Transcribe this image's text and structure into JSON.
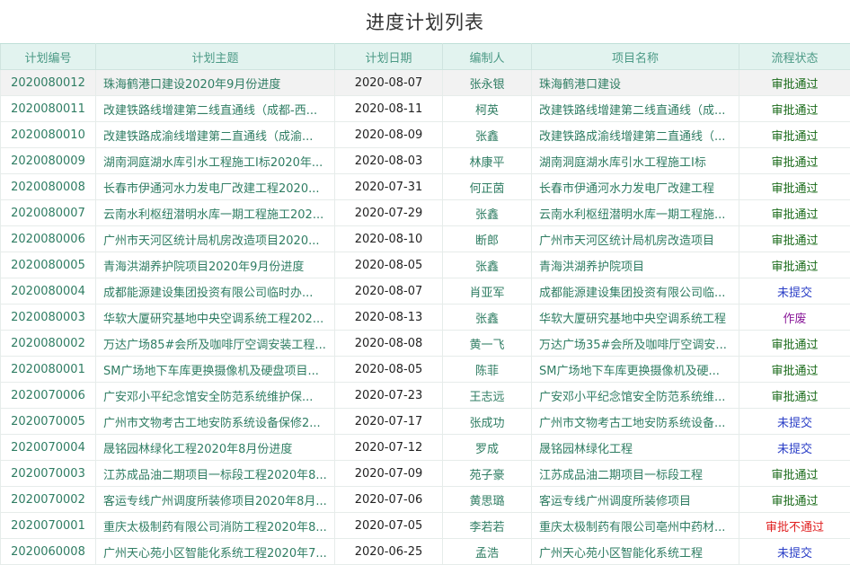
{
  "page": {
    "title": "进度计划列表"
  },
  "table": {
    "columns": [
      "计划编号",
      "计划主题",
      "计划日期",
      "编制人",
      "项目名称",
      "流程状态"
    ],
    "rows": [
      {
        "code": "2020080012",
        "topic": "珠海鹤港口建设2020年9月份进度",
        "date": "2020-08-07",
        "author": "张永银",
        "project": "珠海鹤港口建设",
        "status": "审批通过",
        "status_type": "approved"
      },
      {
        "code": "2020080011",
        "topic": "改建铁路线增建第二线直通线（成都-西...",
        "date": "2020-08-11",
        "author": "柯英",
        "project": "改建铁路线增建第二线直通线（成...",
        "status": "审批通过",
        "status_type": "approved"
      },
      {
        "code": "2020080010",
        "topic": "改建铁路成渝线增建第二直通线（成渝...",
        "date": "2020-08-09",
        "author": "张鑫",
        "project": "改建铁路成渝线增建第二直通线（...",
        "status": "审批通过",
        "status_type": "approved"
      },
      {
        "code": "2020080009",
        "topic": "湖南洞庭湖水库引水工程施工I标2020年...",
        "date": "2020-08-03",
        "author": "林康平",
        "project": "湖南洞庭湖水库引水工程施工I标",
        "status": "审批通过",
        "status_type": "approved"
      },
      {
        "code": "2020080008",
        "topic": "长春市伊通河水力发电厂改建工程2020...",
        "date": "2020-07-31",
        "author": "何正茵",
        "project": "长春市伊通河水力发电厂改建工程",
        "status": "审批通过",
        "status_type": "approved"
      },
      {
        "code": "2020080007",
        "topic": "云南水利枢纽潜明水库一期工程施工202...",
        "date": "2020-07-29",
        "author": "张鑫",
        "project": "云南水利枢纽潜明水库一期工程施...",
        "status": "审批通过",
        "status_type": "approved"
      },
      {
        "code": "2020080006",
        "topic": "广州市天河区统计局机房改造项目2020...",
        "date": "2020-08-10",
        "author": "断郎",
        "project": "广州市天河区统计局机房改造项目",
        "status": "审批通过",
        "status_type": "approved"
      },
      {
        "code": "2020080005",
        "topic": "青海洪湖养护院项目2020年9月份进度",
        "date": "2020-08-05",
        "author": "张鑫",
        "project": "青海洪湖养护院项目",
        "status": "审批通过",
        "status_type": "approved"
      },
      {
        "code": "2020080004",
        "topic": "成都能源建设集团投资有限公司临时办...",
        "date": "2020-08-07",
        "author": "肖亚军",
        "project": "成都能源建设集团投资有限公司临...",
        "status": "未提交",
        "status_type": "unsubmitted"
      },
      {
        "code": "2020080003",
        "topic": "华软大厦研究基地中央空调系统工程202...",
        "date": "2020-08-13",
        "author": "张鑫",
        "project": "华软大厦研究基地中央空调系统工程",
        "status": "作废",
        "status_type": "void"
      },
      {
        "code": "2020080002",
        "topic": "万达广场85#会所及咖啡厅空调安装工程...",
        "date": "2020-08-08",
        "author": "黄一飞",
        "project": "万达广场35#会所及咖啡厅空调安...",
        "status": "审批通过",
        "status_type": "approved"
      },
      {
        "code": "2020080001",
        "topic": "SM广场地下车库更换摄像机及硬盘项目...",
        "date": "2020-08-05",
        "author": "陈菲",
        "project": "SM广场地下车库更换摄像机及硬...",
        "status": "审批通过",
        "status_type": "approved"
      },
      {
        "code": "2020070006",
        "topic": "广安邓小平纪念馆安全防范系统维护保...",
        "date": "2020-07-23",
        "author": "王志远",
        "project": "广安邓小平纪念馆安全防范系统维...",
        "status": "审批通过",
        "status_type": "approved"
      },
      {
        "code": "2020070005",
        "topic": "广州市文物考古工地安防系统设备保修2...",
        "date": "2020-07-17",
        "author": "张成功",
        "project": "广州市文物考古工地安防系统设备...",
        "status": "未提交",
        "status_type": "unsubmitted"
      },
      {
        "code": "2020070004",
        "topic": "晟铭园林绿化工程2020年8月份进度",
        "date": "2020-07-12",
        "author": "罗成",
        "project": "晟铭园林绿化工程",
        "status": "未提交",
        "status_type": "unsubmitted"
      },
      {
        "code": "2020070003",
        "topic": "江苏成品油二期项目一标段工程2020年8...",
        "date": "2020-07-09",
        "author": "苑子豪",
        "project": "江苏成品油二期项目一标段工程",
        "status": "审批通过",
        "status_type": "approved"
      },
      {
        "code": "2020070002",
        "topic": "客运专线广州调度所装修项目2020年8月...",
        "date": "2020-07-06",
        "author": "黄思璐",
        "project": "客运专线广州调度所装修项目",
        "status": "审批通过",
        "status_type": "approved"
      },
      {
        "code": "2020070001",
        "topic": "重庆太极制药有限公司消防工程2020年8...",
        "date": "2020-07-05",
        "author": "李若若",
        "project": "重庆太极制药有限公司亳州中药材...",
        "status": "审批不通过",
        "status_type": "rejected"
      },
      {
        "code": "2020060008",
        "topic": "广州天心苑小区智能化系统工程2020年7...",
        "date": "2020-06-25",
        "author": "孟浩",
        "project": "广州天心苑小区智能化系统工程",
        "status": "未提交",
        "status_type": "unsubmitted"
      }
    ]
  },
  "colors": {
    "header_bg": "#e2f3ef",
    "header_text": "#4c9a86",
    "row_text": "#2f7d63",
    "status_approved": "#1a6b1a",
    "status_unsubmitted": "#2b3fc7",
    "status_void": "#8a1a9a",
    "status_rejected": "#e02020"
  }
}
